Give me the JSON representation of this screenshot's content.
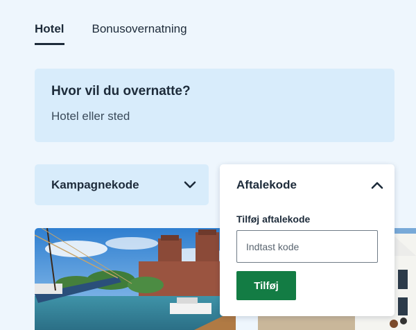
{
  "tabs": [
    {
      "label": "Hotel",
      "active": true
    },
    {
      "label": "Bonusovernatning",
      "active": false
    }
  ],
  "destination": {
    "title": "Hvor vil du overnatte?",
    "placeholder": "Hotel eller sted"
  },
  "campaign": {
    "label": "Kampagnekode",
    "icon": "chevron-down-icon"
  },
  "agreement": {
    "label": "Aftalekode",
    "icon": "chevron-up-icon",
    "field_label": "Tilføj aftalekode",
    "input_placeholder": "Indtast kode",
    "input_value": "",
    "add_button": "Tilføj"
  },
  "colors": {
    "page_background": "#eef6fd",
    "card_background": "#d8ecfb",
    "text": "#1d2b3a",
    "button_green": "#137c44"
  }
}
